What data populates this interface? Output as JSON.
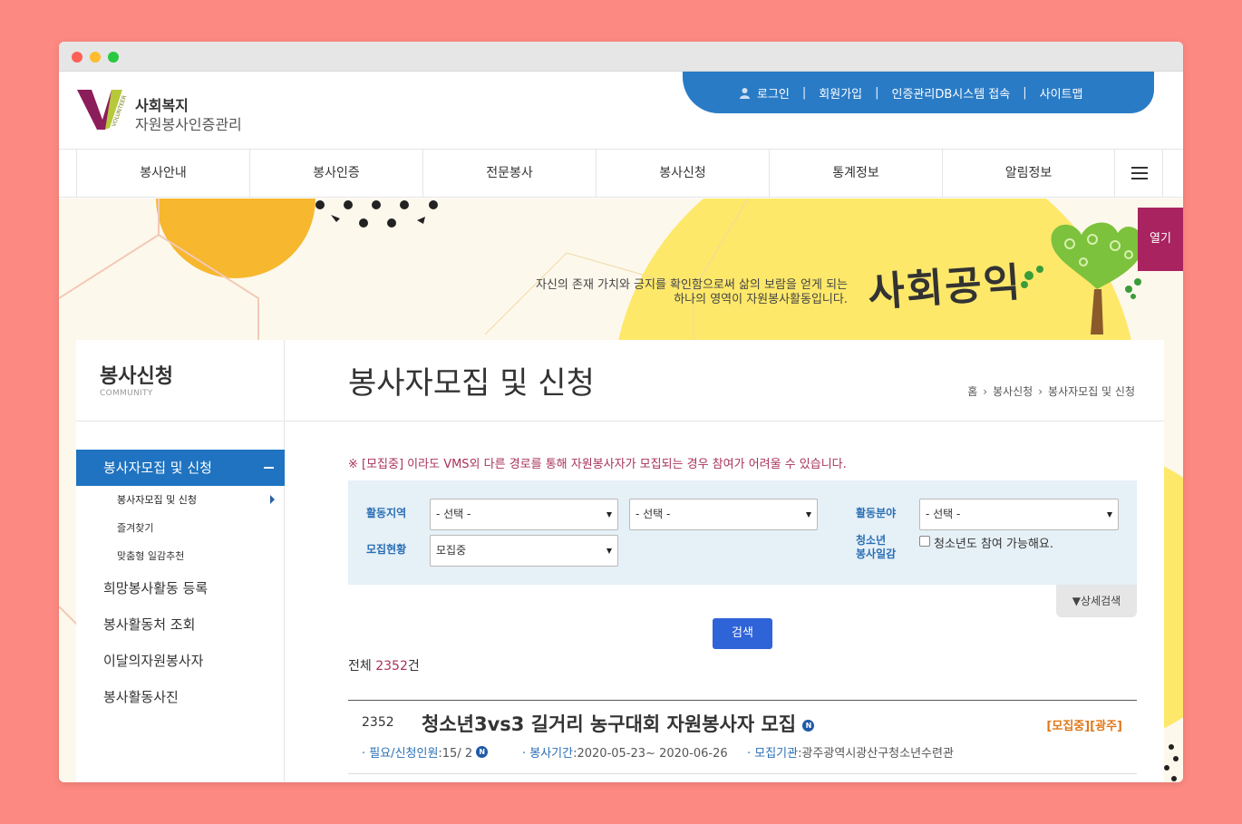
{
  "header": {
    "logo_line1": "사회복지",
    "logo_line2": "자원봉사인증관리",
    "logo_vertical_text": "VOLUNTEER",
    "top_links": [
      "로그인",
      "회원가입",
      "인증관리DB시스템 접속",
      "사이트맵"
    ]
  },
  "gnb": {
    "items": [
      "봉사안내",
      "봉사인증",
      "전문봉사",
      "봉사신청",
      "통계정보",
      "알림정보"
    ]
  },
  "banner": {
    "slogan_line1": "자신의 존재 가치와 긍지를 확인함으로써 삶의 보람을 얻게 되는",
    "slogan_line2": "하나의 영역이 자원봉사활동입니다.",
    "brush_text": "사회공익",
    "open_label": "열기"
  },
  "lnb": {
    "title": "봉사신청",
    "subtitle": "COMMUNITY",
    "active_item": "봉사자모집 및 신청",
    "sub_items": [
      "봉사자모집 및 신청",
      "즐겨찾기",
      "맞춤형 일감추천"
    ],
    "items": [
      "희망봉사활동 등록",
      "봉사활동처 조회",
      "이달의자원봉사자",
      "봉사활동사진"
    ]
  },
  "main": {
    "page_title": "봉사자모집 및 신청",
    "breadcrumb": [
      "홈",
      "봉사신청",
      "봉사자모집 및 신청"
    ],
    "notice": "※ [모집중] 이라도 VMS외 다른 경로를 통해 자원봉사자가 모집되는 경우 참여가 어려울 수 있습니다.",
    "search": {
      "region_label": "활동지역",
      "region1_value": "- 선택 -",
      "region2_value": "- 선택 -",
      "field_label": "활동분야",
      "field_value": "- 선택 -",
      "status_label": "모집현황",
      "status_value": "모집중",
      "youth_label_1": "청소년",
      "youth_label_2": "봉사일감",
      "youth_checkbox_label": "청소년도 참여 가능해요.",
      "detail_search": "▼상세검색",
      "search_button": "검색"
    },
    "total_prefix": "전체",
    "total_count": "2352",
    "total_suffix": "건",
    "list": [
      {
        "num": "2352",
        "title": "청소년3vs3 길거리 농구대회 자원봉사자 모집",
        "new_badge": "N",
        "status": "[모집중][광주]",
        "need_label": "필요/신청인원",
        "need_value": ":15/ 2",
        "period_label": "봉사기간",
        "period_value": ":2020-05-23~ 2020-06-26",
        "org_label": "모집기관",
        "org_value": ":광주광역시광산구청소년수련관"
      }
    ]
  },
  "colors": {
    "page_bg": "#fd8a82",
    "topbar_blue": "#2a7bc6",
    "active_blue": "#1f73c0",
    "accent_magenta": "#a82360",
    "search_btn": "#2f63d8",
    "status_orange": "#e0781a"
  },
  "icons": {
    "user": "user-icon",
    "menu": "hamburger-menu-icon",
    "new": "new-badge-icon"
  }
}
